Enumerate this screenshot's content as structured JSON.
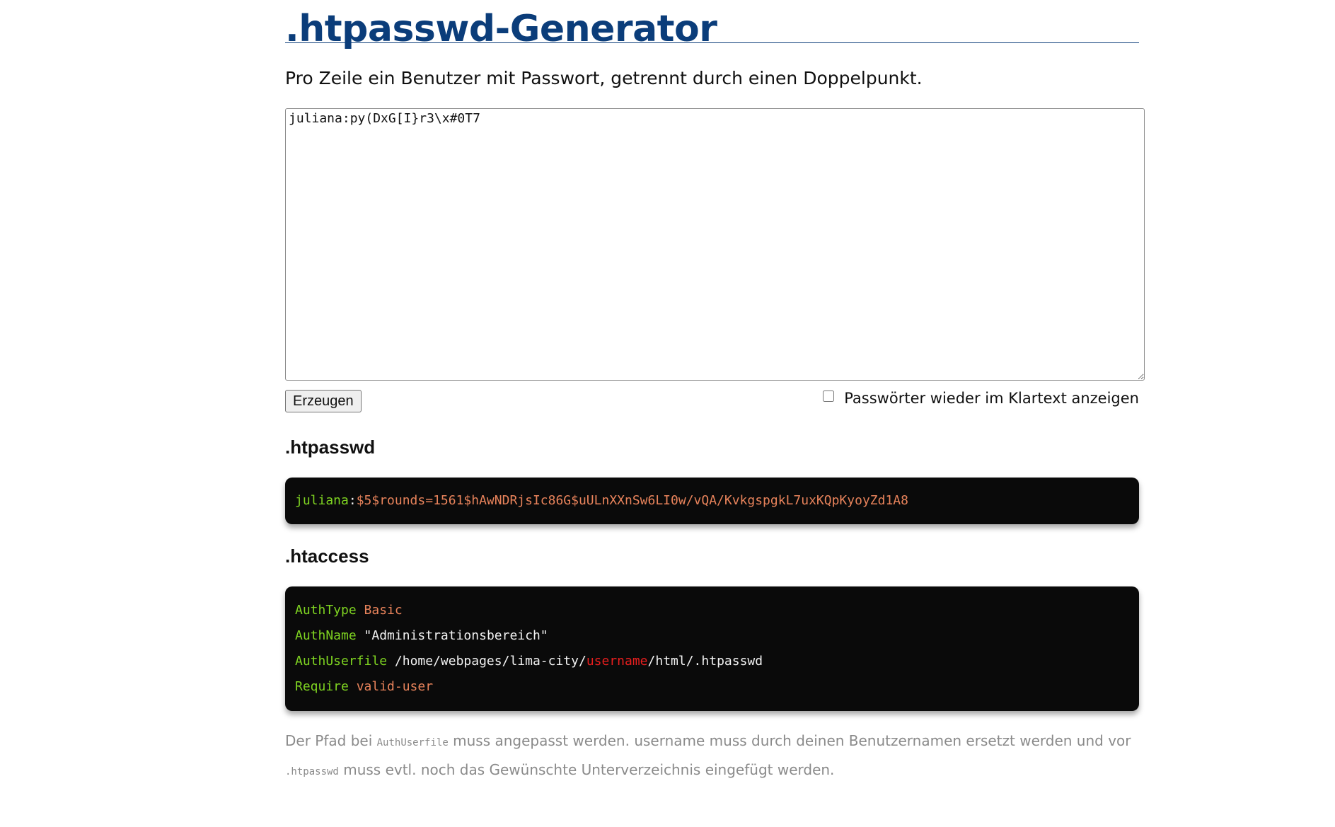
{
  "page": {
    "title": ".htpasswd-Generator",
    "intro": "Pro Zeile ein Benutzer mit Passwort, getrennt durch einen Doppelpunkt."
  },
  "form": {
    "textarea_value": "juliana:py(DxG[I}r3\\x#0T7",
    "submit_label": "Erzeugen",
    "show_plaintext_label": "Passwörter wieder im Klartext anzeigen",
    "show_plaintext_checked": false
  },
  "htpasswd": {
    "heading": ".htpasswd",
    "user": "juliana",
    "separator": ":",
    "hash": "$5$rounds=1561$hAwNDRjsIc86G$uULnXXnSw6LI0w/vQA/KvkgspgkL7uxKQpKyoyZd1A8"
  },
  "htaccess": {
    "heading": ".htaccess",
    "lines": [
      {
        "key": "AuthType",
        "value": "Basic"
      },
      {
        "key": "AuthName",
        "value": "\"Administrationsbereich\""
      },
      {
        "key": "AuthUserfile",
        "path_before": "/home/webpages/lima-city/",
        "path_highlight": "username",
        "path_after": "/html/.htpasswd"
      },
      {
        "key": "Require",
        "value": "valid-user"
      }
    ]
  },
  "note": {
    "part1": "Der Pfad bei ",
    "code1": "AuthUserfile",
    "part2": " muss angepasst werden. username muss durch deinen Benutzernamen ersetzt werden und vor ",
    "code2": ".htpasswd",
    "part3": " muss evtl. noch das Gewünschte Unterverzeichnis eingefügt werden."
  },
  "colors": {
    "title": "#0b3d7a",
    "code_background": "#0a0a0a",
    "code_keyword": "#7ed321",
    "code_value": "#e8835b",
    "code_highlight": "#e81e1e",
    "note_text": "#8a8a8a"
  }
}
